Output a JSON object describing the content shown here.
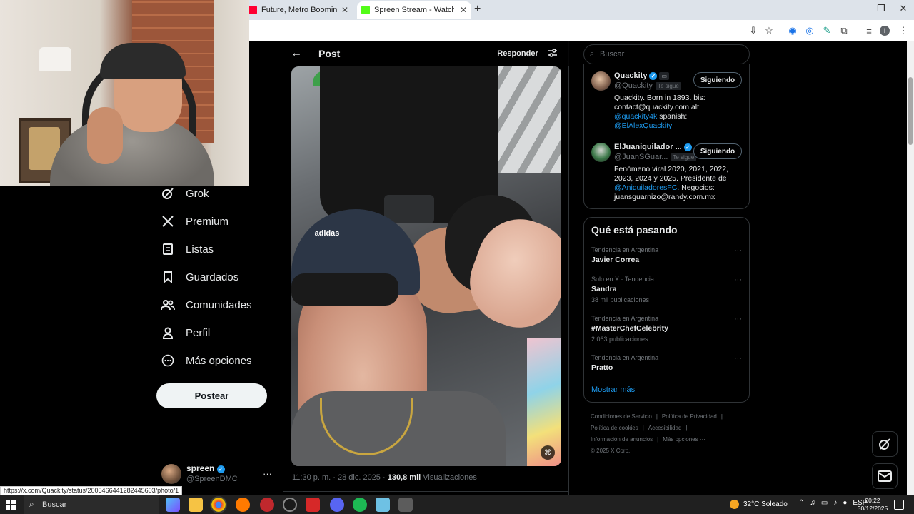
{
  "browser": {
    "tabs": [
      {
        "title": "Future, Metro Boomin, Kendrick",
        "favicon_color": "#ff0033"
      },
      {
        "title": "Spreen Stream - Watch Live on",
        "favicon_color": "#53fc18"
      }
    ],
    "new_tab": "+",
    "window": {
      "minimize": "—",
      "restore": "❐",
      "close": "✕"
    }
  },
  "nav": {
    "items": [
      {
        "label": "Grok",
        "icon": "grok-icon"
      },
      {
        "label": "Premium",
        "icon": "x-logo-icon"
      },
      {
        "label": "Listas",
        "icon": "list-icon"
      },
      {
        "label": "Guardados",
        "icon": "bookmark-icon"
      },
      {
        "label": "Comunidades",
        "icon": "communities-icon"
      },
      {
        "label": "Perfil",
        "icon": "profile-icon"
      },
      {
        "label": "Más opciones",
        "icon": "more-options-icon"
      }
    ],
    "post_button": "Postear",
    "account": {
      "name": "spreen",
      "handle": "@SpreenDMC",
      "more": "···"
    }
  },
  "post": {
    "header_title": "Post",
    "reply_button": "Responder",
    "photo_logo_text": "adidas",
    "meta_time": "11:30 p. m. · 28 dic. 2025 · ",
    "meta_views": "130,8 mil",
    "meta_views_label": " Visualizaciones"
  },
  "search": {
    "placeholder": "Buscar"
  },
  "who_to_follow": [
    {
      "name": "Quackity",
      "handle": "@Quackity",
      "badge": "Te sigue",
      "button": "Siguiendo",
      "bio_text": "Quackity. Born in 1893. bis: contact@quackity.com alt: ",
      "bio_link1": "@quackity4k",
      "bio_mid": " spanish: ",
      "bio_link2": "@ElAlexQuackity",
      "bio_end": ""
    },
    {
      "name": "ElJuaniquilador ...",
      "handle": "@JuanSGuar...",
      "badge": "Te sigue",
      "button": "Siguiendo",
      "bio_text": "Fenómeno viral 2020, 2021, 2022, 2023, 2024 y 2025. Presidente de ",
      "bio_link1": "@AniquiladoresFC",
      "bio_mid": ". Negocios: juansguarnizo@randy.com.mx",
      "bio_link2": "",
      "bio_end": ""
    }
  ],
  "trends": {
    "title": "Qué está pasando",
    "items": [
      {
        "context": "Tendencia en Argentina",
        "name": "Javier Correa",
        "count": ""
      },
      {
        "context": "Solo en X · Tendencia",
        "name": "Sandra",
        "count": "38 mil publicaciones"
      },
      {
        "context": "Tendencia en Argentina",
        "name": "#MasterChefCelebrity",
        "count": "2.063 publicaciones"
      },
      {
        "context": "Tendencia en Argentina",
        "name": "Pratto",
        "count": ""
      }
    ],
    "more_dots": "···",
    "show_more": "Mostrar más"
  },
  "footer": {
    "links": [
      "Condiciones de Servicio",
      "|",
      "Política de Privacidad",
      "|",
      "Política de cookies",
      "|",
      "Accesibilidad",
      "|",
      "Información de anuncios",
      "|",
      "Más opciones ···"
    ],
    "copyright": "© 2025 X Corp."
  },
  "status_url": "https://x.com/Quackity/status/2005466441282445603/photo/1",
  "taskbar": {
    "search": "Buscar",
    "weather": "32°C  Soleado",
    "lang": "ESP",
    "time": "00:22",
    "date": "30/12/2025"
  }
}
